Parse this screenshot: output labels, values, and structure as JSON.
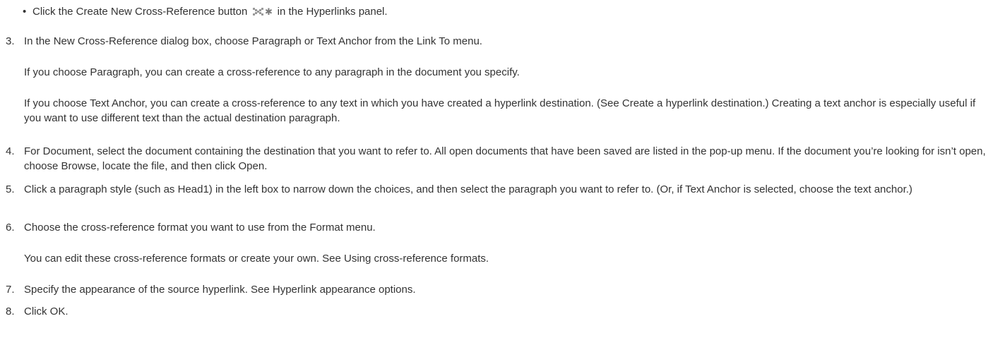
{
  "bullet": {
    "before": "Click the Create New Cross-Reference button",
    "icon": "create-cross-reference-icon",
    "after": "in the Hyperlinks panel."
  },
  "steps": [
    {
      "number": "3.",
      "text": "In the New Cross-Reference dialog box, choose Paragraph or Text Anchor from the Link To menu.",
      "notes": [
        "If you choose Paragraph, you can create a cross-reference to any paragraph in the document you specify.",
        "If you choose Text Anchor, you can create a cross-reference to any text in which you have created a hyperlink destination. (See Create a hyperlink destination.) Creating a text anchor is especially useful if you want to use different text than the actual destination paragraph."
      ]
    },
    {
      "number": "4.",
      "text": "For Document, select the document containing the destination that you want to refer to. All open documents that have been saved are listed in the pop-up menu. If the document you’re looking for isn’t open, choose Browse, locate the file, and then click Open."
    },
    {
      "number": "5.",
      "text": "Click a paragraph style (such as Head1) in the left box to narrow down the choices, and then select the paragraph you want to refer to. (Or, if Text Anchor is selected, choose the text anchor.)"
    },
    {
      "number": "6.",
      "text": "Choose the cross-reference format you want to use from the Format menu.",
      "notes": [
        "You can edit these cross-reference formats or create your own. See Using cross-reference formats."
      ]
    },
    {
      "number": "7.",
      "text": "Specify the appearance of the source hyperlink. See Hyperlink appearance options."
    },
    {
      "number": "8.",
      "text": "Click OK."
    }
  ]
}
